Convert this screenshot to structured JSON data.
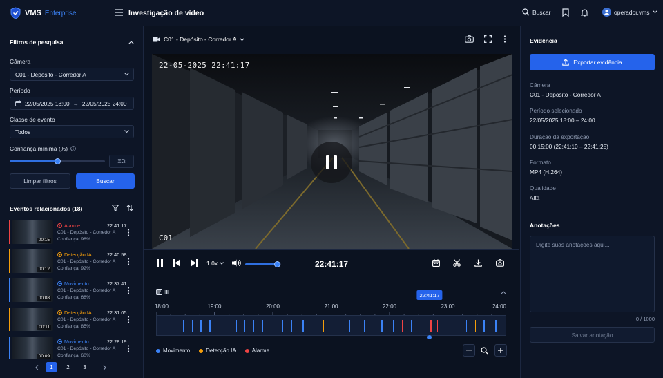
{
  "app": {
    "brand_main": "VMS",
    "brand_sub": "Enterprise",
    "page_title": "Investigação de vídeo"
  },
  "topbar": {
    "search_label": "Buscar",
    "user": "operador.vms"
  },
  "filters": {
    "title": "Filtros de pesquisa",
    "camera_label": "Câmera",
    "camera_value": "C01 - Depósito - Corredor A",
    "period_label": "Período",
    "period_start": "22/05/2025 18:00",
    "period_end": "22/05/2025 24:00",
    "event_class_label": "Classe de evento",
    "event_class_value": "Todos",
    "confidence_label": "Confiança mínima (%)",
    "confidence_value": 50,
    "confidence_box": "ΞΩ",
    "clear_label": "Limpar filtros",
    "search_label": "Buscar"
  },
  "events": {
    "title": "Eventos relacionados (18)",
    "items": [
      {
        "type": "Alarme",
        "time": "22:41:17",
        "camera": "C01 - Depósito - Corredor A",
        "confidence": "Confiança: 98%",
        "duration": "00:15",
        "color": "#ef4444"
      },
      {
        "type": "Detecção IA",
        "time": "22:40:58",
        "camera": "C01 - Depósito - Corredor A",
        "confidence": "Confiança: 92%",
        "duration": "00:12",
        "color": "#f59e0b"
      },
      {
        "type": "Movimento",
        "time": "22:37:41",
        "camera": "C01 - Depósito - Corredor A",
        "confidence": "Confiança: 68%",
        "duration": "00:08",
        "color": "#3b82f6"
      },
      {
        "type": "Detecção IA",
        "time": "22:31:05",
        "camera": "C01 - Depósito - Corredor A",
        "confidence": "Confiança: 85%",
        "duration": "00:11",
        "color": "#f59e0b"
      },
      {
        "type": "Movimento",
        "time": "22:28:19",
        "camera": "C01 - Depósito - Corredor A",
        "confidence": "Confiança: 60%",
        "duration": "00:09",
        "color": "#3b82f6"
      }
    ],
    "pages": [
      "1",
      "2",
      "3"
    ],
    "current_page": "1"
  },
  "player": {
    "camera_title": "C01 - Depósito - Corredor A",
    "osd_timestamp": "22-05-2025  22:41:17",
    "osd_camera": "C01",
    "speed": "1.0x",
    "volume": 0.9,
    "clock": "22:41:17"
  },
  "timeline": {
    "labels": [
      "18:00",
      "19:00",
      "20:00",
      "21:00",
      "22:00",
      "23:00",
      "24:00"
    ],
    "playhead_label": "22:41:17",
    "playhead_hours": 22.688,
    "legend": [
      {
        "name": "Movimento",
        "color": "#3b82f6"
      },
      {
        "name": "Detecção IA",
        "color": "#f59e0b"
      },
      {
        "name": "Alarme",
        "color": "#ef4444"
      }
    ],
    "events": [
      {
        "h": 18.45,
        "c": "#3b82f6"
      },
      {
        "h": 18.6,
        "c": "#3b82f6"
      },
      {
        "h": 18.75,
        "c": "#3b82f6"
      },
      {
        "h": 18.9,
        "c": "#3b82f6"
      },
      {
        "h": 19.35,
        "c": "#3b82f6"
      },
      {
        "h": 19.5,
        "c": "#3b82f6"
      },
      {
        "h": 19.65,
        "c": "#3b82f6"
      },
      {
        "h": 19.8,
        "c": "#3b82f6"
      },
      {
        "h": 19.95,
        "c": "#f59e0b"
      },
      {
        "h": 20.15,
        "c": "#3b82f6"
      },
      {
        "h": 20.3,
        "c": "#3b82f6"
      },
      {
        "h": 20.5,
        "c": "#3b82f6"
      },
      {
        "h": 20.85,
        "c": "#f59e0b"
      },
      {
        "h": 21.1,
        "c": "#3b82f6"
      },
      {
        "h": 21.3,
        "c": "#3b82f6"
      },
      {
        "h": 21.55,
        "c": "#3b82f6"
      },
      {
        "h": 21.85,
        "c": "#3b82f6"
      },
      {
        "h": 22.05,
        "c": "#3b82f6"
      },
      {
        "h": 22.2,
        "c": "#ef4444"
      },
      {
        "h": 22.35,
        "c": "#3b82f6"
      },
      {
        "h": 22.52,
        "c": "#f59e0b"
      },
      {
        "h": 22.69,
        "c": "#ef4444"
      },
      {
        "h": 22.8,
        "c": "#ef4444"
      },
      {
        "h": 23.05,
        "c": "#3b82f6"
      },
      {
        "h": 23.3,
        "c": "#3b82f6"
      },
      {
        "h": 23.45,
        "c": "#f59e0b"
      },
      {
        "h": 23.6,
        "c": "#3b82f6"
      },
      {
        "h": 23.8,
        "c": "#3b82f6"
      }
    ]
  },
  "evidence": {
    "title": "Evidência",
    "export_label": "Exportar evidência",
    "fields": [
      {
        "k": "Câmera",
        "v": "C01 - Depósito - Corredor A"
      },
      {
        "k": "Período selecionado",
        "v": "22/05/2025 18:00 – 24:00"
      },
      {
        "k": "Duração da exportação",
        "v": "00:15:00 (22:41:10 – 22:41:25)"
      },
      {
        "k": "Formato",
        "v": "MP4 (H.264)"
      },
      {
        "k": "Qualidade",
        "v": "Alta"
      }
    ]
  },
  "notes": {
    "title": "Anotações",
    "placeholder": "Digite suas anotações aqui...",
    "counter": "0 / 1000",
    "save_label": "Salvar anotação"
  },
  "colors": {
    "accent": "#2563eb",
    "alarm": "#ef4444",
    "ai": "#f59e0b",
    "motion": "#3b82f6"
  }
}
